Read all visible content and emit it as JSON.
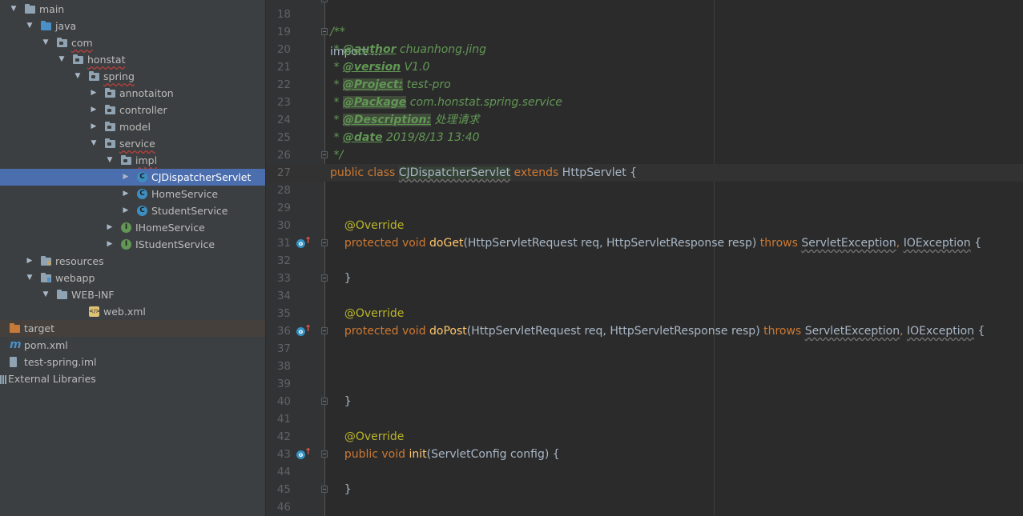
{
  "tree": {
    "items": [
      {
        "label": "main",
        "arrow": "▼",
        "icon": "folder",
        "indent": 0
      },
      {
        "label": "java",
        "arrow": "▼",
        "icon": "folder-src",
        "indent": 1
      },
      {
        "label": "com",
        "arrow": "▼",
        "icon": "folder-pkg",
        "indent": 2,
        "wavy": true
      },
      {
        "label": "honstat",
        "arrow": "▼",
        "icon": "folder-pkg",
        "indent": 3,
        "wavy": true
      },
      {
        "label": "spring",
        "arrow": "▼",
        "icon": "folder-pkg",
        "indent": 4,
        "wavy": true
      },
      {
        "label": "annotaiton",
        "arrow": "▶",
        "icon": "folder-pkg",
        "indent": 5
      },
      {
        "label": "controller",
        "arrow": "▶",
        "icon": "folder-pkg",
        "indent": 5
      },
      {
        "label": "model",
        "arrow": "▶",
        "icon": "folder-pkg",
        "indent": 5
      },
      {
        "label": "service",
        "arrow": "▼",
        "icon": "folder-pkg",
        "indent": 5,
        "wavy": true
      },
      {
        "label": "impl",
        "arrow": "▼",
        "icon": "folder-pkg",
        "indent": 6,
        "wavy": true
      },
      {
        "label": "CJDispatcherServlet",
        "arrow": "▶",
        "icon": "class",
        "indent": 7,
        "selected": true
      },
      {
        "label": "HomeService",
        "arrow": "▶",
        "icon": "class",
        "indent": 7
      },
      {
        "label": "StudentService",
        "arrow": "▶",
        "icon": "class",
        "indent": 7
      },
      {
        "label": "IHomeService",
        "arrow": "▶",
        "icon": "interface",
        "indent": 6
      },
      {
        "label": "IStudentService",
        "arrow": "▶",
        "icon": "interface",
        "indent": 6
      },
      {
        "label": "resources",
        "arrow": "▶",
        "icon": "folder-res",
        "indent": 1
      },
      {
        "label": "webapp",
        "arrow": "▼",
        "icon": "folder-web",
        "indent": 1
      },
      {
        "label": "WEB-INF",
        "arrow": "▼",
        "icon": "folder",
        "indent": 2
      },
      {
        "label": "web.xml",
        "arrow": "",
        "icon": "xml",
        "indent": 4
      },
      {
        "label": "target",
        "arrow": "",
        "icon": "folder-target",
        "indent": -1,
        "excluded": true
      },
      {
        "label": "pom.xml",
        "arrow": "",
        "icon": "maven",
        "indent": -1
      },
      {
        "label": "test-spring.iml",
        "arrow": "",
        "icon": "iml",
        "indent": -1
      },
      {
        "label": "External Libraries",
        "arrow": "",
        "icon": "libraries",
        "indent": -2
      }
    ]
  },
  "editor": {
    "first_line_partial": "import ...",
    "lines": [
      {
        "n": "18",
        "tokens": []
      },
      {
        "n": "19",
        "fold": true,
        "tokens": [
          {
            "t": "/**",
            "c": "doc"
          }
        ]
      },
      {
        "n": "20",
        "tokens": [
          {
            "t": " * ",
            "c": "doc"
          },
          {
            "t": "@author",
            "c": "tag"
          },
          {
            "t": " chuanhong.jing",
            "c": "doc"
          }
        ]
      },
      {
        "n": "21",
        "tokens": [
          {
            "t": " * ",
            "c": "doc"
          },
          {
            "t": "@version",
            "c": "tag"
          },
          {
            "t": " V1.0",
            "c": "doc"
          }
        ]
      },
      {
        "n": "22",
        "tokens": [
          {
            "t": " * ",
            "c": "doc"
          },
          {
            "t": "@Project:",
            "c": "tag hl"
          },
          {
            "t": " test-pro",
            "c": "doc"
          }
        ]
      },
      {
        "n": "23",
        "tokens": [
          {
            "t": " * ",
            "c": "doc"
          },
          {
            "t": "@Package",
            "c": "tag hl"
          },
          {
            "t": " com.honstat.spring.service",
            "c": "doc"
          }
        ]
      },
      {
        "n": "24",
        "tokens": [
          {
            "t": " * ",
            "c": "doc"
          },
          {
            "t": "@Description:",
            "c": "tag hl"
          },
          {
            "t": " 处理请求",
            "c": "doc"
          }
        ]
      },
      {
        "n": "25",
        "tokens": [
          {
            "t": " * ",
            "c": "doc"
          },
          {
            "t": "@date",
            "c": "tag"
          },
          {
            "t": " 2019/8/13 13:40",
            "c": "doc"
          }
        ]
      },
      {
        "n": "26",
        "fold": true,
        "tokens": [
          {
            "t": " */",
            "c": "doc"
          }
        ]
      },
      {
        "n": "27",
        "current": true,
        "tokens": [
          {
            "t": "public class ",
            "c": "kw"
          },
          {
            "t": "CJDispatcherServlet",
            "c": "plain cls-hl cls-wavy"
          },
          {
            "t": " extends ",
            "c": "kw"
          },
          {
            "t": "HttpServlet {",
            "c": "plain"
          }
        ]
      },
      {
        "n": "28",
        "tokens": []
      },
      {
        "n": "29",
        "tokens": []
      },
      {
        "n": "30",
        "tokens": [
          {
            "t": "    ",
            "c": "plain"
          },
          {
            "t": "@Override",
            "c": "ann"
          }
        ]
      },
      {
        "n": "31",
        "override": true,
        "fold": true,
        "tokens": [
          {
            "t": "    ",
            "c": "plain"
          },
          {
            "t": "protected void ",
            "c": "kw"
          },
          {
            "t": "doGet",
            "c": "fn"
          },
          {
            "t": "(HttpServletRequest req, HttpServletResponse resp) ",
            "c": "plain"
          },
          {
            "t": "throws ",
            "c": "kw"
          },
          {
            "t": "ServletException",
            "c": "plain wavy"
          },
          {
            "t": ", ",
            "c": "kw"
          },
          {
            "t": "IOException",
            "c": "plain wavy"
          },
          {
            "t": " {",
            "c": "plain"
          }
        ]
      },
      {
        "n": "32",
        "tokens": []
      },
      {
        "n": "33",
        "fold": true,
        "tokens": [
          {
            "t": "    }",
            "c": "plain"
          }
        ]
      },
      {
        "n": "34",
        "tokens": []
      },
      {
        "n": "35",
        "tokens": [
          {
            "t": "    ",
            "c": "plain"
          },
          {
            "t": "@Override",
            "c": "ann"
          }
        ]
      },
      {
        "n": "36",
        "override": true,
        "fold": true,
        "tokens": [
          {
            "t": "    ",
            "c": "plain"
          },
          {
            "t": "protected void ",
            "c": "kw"
          },
          {
            "t": "doPost",
            "c": "fn"
          },
          {
            "t": "(HttpServletRequest req, HttpServletResponse resp) ",
            "c": "plain"
          },
          {
            "t": "throws ",
            "c": "kw"
          },
          {
            "t": "ServletException",
            "c": "plain wavy"
          },
          {
            "t": ", ",
            "c": "kw"
          },
          {
            "t": "IOException",
            "c": "plain wavy"
          },
          {
            "t": " {",
            "c": "plain"
          }
        ]
      },
      {
        "n": "37",
        "tokens": []
      },
      {
        "n": "38",
        "tokens": []
      },
      {
        "n": "39",
        "tokens": []
      },
      {
        "n": "40",
        "fold": true,
        "tokens": [
          {
            "t": "    }",
            "c": "plain"
          }
        ]
      },
      {
        "n": "41",
        "tokens": []
      },
      {
        "n": "42",
        "tokens": [
          {
            "t": "    ",
            "c": "plain"
          },
          {
            "t": "@Override",
            "c": "ann"
          }
        ]
      },
      {
        "n": "43",
        "override": true,
        "fold": true,
        "tokens": [
          {
            "t": "    ",
            "c": "plain"
          },
          {
            "t": "public void ",
            "c": "kw"
          },
          {
            "t": "init",
            "c": "fn"
          },
          {
            "t": "(ServletConfig config) {",
            "c": "plain"
          }
        ]
      },
      {
        "n": "44",
        "tokens": []
      },
      {
        "n": "45",
        "fold": true,
        "tokens": [
          {
            "t": "    }",
            "c": "plain"
          }
        ]
      },
      {
        "n": "46",
        "tokens": []
      }
    ]
  },
  "colors": {
    "tree_bg": "#3c3f41",
    "editor_bg": "#2b2b2b",
    "selection": "#4b6eaf",
    "keyword": "#cc7832",
    "method": "#ffc66d",
    "annotation": "#bbb529",
    "doc_comment": "#629755"
  }
}
